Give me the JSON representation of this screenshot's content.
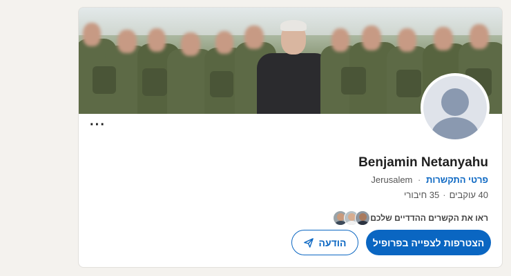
{
  "profile": {
    "name": "Benjamin Netanyahu",
    "location": "Jerusalem",
    "separator": "·",
    "contact_info_label": "פרטי התקשרות",
    "followers": "40 עוקבים",
    "connections": "35 חיבורי",
    "mutual_text": "ראו את הקשרים ההדדיים שלכם",
    "more_label": "···"
  },
  "actions": {
    "primary_label": "הצטרפות לצפייה בפרופיל",
    "message_label": "הודעה",
    "message_icon": "send-icon"
  },
  "colors": {
    "accent": "#0a66c2",
    "page_bg": "#f4f2ee"
  }
}
